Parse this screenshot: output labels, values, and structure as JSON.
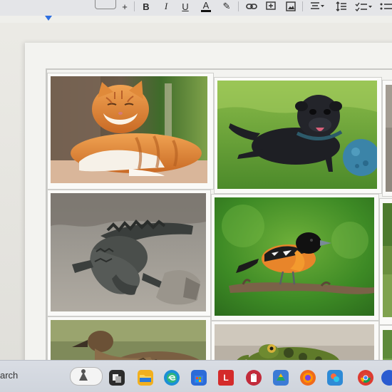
{
  "toolbar": {
    "style_dropdown_label": "",
    "buttons": [
      {
        "name": "add-menu-button",
        "glyph": "+"
      },
      {
        "name": "bold-button",
        "glyph": "B"
      },
      {
        "name": "italic-button",
        "glyph": "I"
      },
      {
        "name": "underline-button",
        "glyph": "U"
      },
      {
        "name": "text-color-button",
        "glyph": "A"
      },
      {
        "name": "highlight-button",
        "glyph": "✎"
      },
      {
        "name": "insert-link-button",
        "glyph": "🔗"
      },
      {
        "name": "insert-comment-button",
        "glyph": "＋"
      },
      {
        "name": "insert-image-button",
        "glyph": "▣"
      },
      {
        "name": "align-button",
        "glyph": "≡"
      },
      {
        "name": "line-spacing-button",
        "glyph": "↕"
      },
      {
        "name": "checklist-button",
        "glyph": "☑"
      },
      {
        "name": "bulleted-list-button",
        "glyph": "•"
      }
    ]
  },
  "document": {
    "photos": [
      {
        "name": "cat-photo",
        "subject": "orange tabby cat"
      },
      {
        "name": "pug-photo",
        "subject": "black pug with blue ball"
      },
      {
        "name": "alligator-photo",
        "subject": "alligator"
      },
      {
        "name": "oriole-photo",
        "subject": "oriole bird on branch"
      },
      {
        "name": "duck-photo",
        "subject": "mallard duck"
      },
      {
        "name": "frog-photo",
        "subject": "green frog"
      }
    ]
  },
  "taskbar": {
    "search_text": "arch",
    "apps": [
      {
        "name": "task-view-icon",
        "color": "#2c2c2c"
      },
      {
        "name": "file-explorer-icon",
        "color": "#f2b01e"
      },
      {
        "name": "edge-icon",
        "color": "#1b8fd6"
      },
      {
        "name": "store-icon",
        "color": "#2b6bd8"
      },
      {
        "name": "red-l-app-icon",
        "color": "#d42b2b",
        "glyph": "L"
      },
      {
        "name": "lastpass-icon",
        "color": "#c22b3b"
      },
      {
        "name": "drive-icon",
        "color": "#3b7bd6"
      },
      {
        "name": "firefox-icon",
        "color": "#f06a1c"
      },
      {
        "name": "photos-icon",
        "color": "#2d8ad6"
      },
      {
        "name": "chrome-icon",
        "color": "#dd3b30"
      }
    ]
  }
}
